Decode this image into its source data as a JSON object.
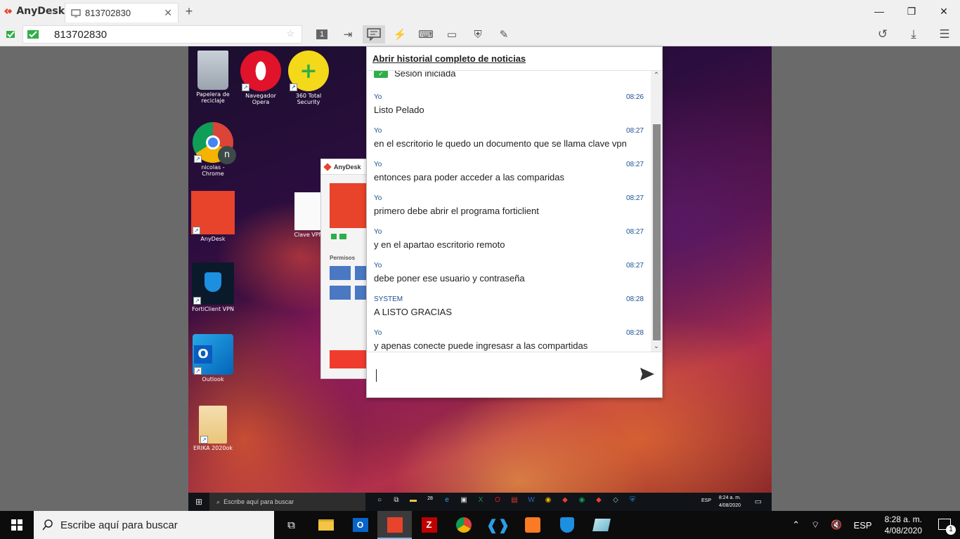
{
  "app": {
    "name": "AnyDesk"
  },
  "tab": {
    "label": "813702830",
    "close": "✕"
  },
  "address": {
    "value": "813702830"
  },
  "toolbar": {
    "monitor_number": "1"
  },
  "desktop": {
    "icons": [
      {
        "label": "Papelera de reciclaje",
        "icon": "recycle-bin-icon"
      },
      {
        "label": "Navegador Opera",
        "icon": "opera-icon"
      },
      {
        "label": "360 Total Security",
        "icon": "360-security-icon"
      },
      {
        "label": "nicolas - Chrome",
        "icon": "chrome-icon",
        "badge": "n"
      },
      {
        "label": "AnyDesk",
        "icon": "anydesk-icon"
      },
      {
        "label": "Clave VPN",
        "icon": "document-icon"
      },
      {
        "label": "FortiClient VPN",
        "icon": "forticlient-icon"
      },
      {
        "label": "Outlook",
        "icon": "outlook-icon"
      },
      {
        "label": "ERIKA 2020ok",
        "icon": "excel-file-icon"
      }
    ],
    "anydesk_mini": {
      "title": "AnyDesk",
      "permissions": "Permisos"
    },
    "taskbar": {
      "search_placeholder": "Escribe aquí para buscar",
      "lang": "ESP",
      "time": "8:24 a. m.",
      "date": "4/08/2020",
      "badge": "28"
    }
  },
  "chat": {
    "header": "Abrir historial completo de noticias",
    "session": "Sesión iniciada",
    "messages": [
      {
        "sender": "Yo",
        "time": "08:26",
        "text": "Listo Pelado"
      },
      {
        "sender": "Yo",
        "time": "08:27",
        "text": "en el escritorio le quedo un documento que se llama clave vpn"
      },
      {
        "sender": "Yo",
        "time": "08:27",
        "text": "entonces para poder acceder a las comparidas"
      },
      {
        "sender": "Yo",
        "time": "08:27",
        "text": "primero debe abrir el programa forticlient"
      },
      {
        "sender": "Yo",
        "time": "08:27",
        "text": "y en el apartao escritorio remoto"
      },
      {
        "sender": "Yo",
        "time": "08:27",
        "text": "debe poner ese usuario y contraseña"
      },
      {
        "sender": "SYSTEM",
        "time": "08:28",
        "text": "A LISTO GRACIAS"
      },
      {
        "sender": "Yo",
        "time": "08:28",
        "text": "y apenas conecte puede ingresasr a las compartidas"
      }
    ],
    "input_value": ""
  },
  "taskbar": {
    "search_placeholder": "Escribe aquí para buscar",
    "lang": "ESP",
    "time": "8:28 a. m.",
    "date": "4/08/2020",
    "notifications": "1"
  },
  "colors": {
    "anydesk_red": "#e8432b",
    "taskbar": "#0c0c0c",
    "chat_meta": "#1a4f8f"
  }
}
